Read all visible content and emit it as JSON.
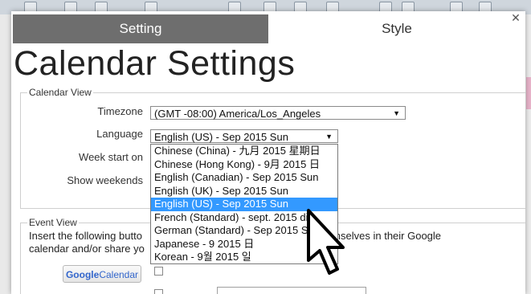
{
  "tabs": [
    {
      "label": "Setting"
    },
    {
      "label": "Style"
    }
  ],
  "page_title": "Calendar Settings",
  "calendar_view": {
    "legend": "Calendar View",
    "timezone_label": "Timezone",
    "timezone_value": "(GMT -08:00) America/Los_Angeles",
    "language_label": "Language",
    "language_value": "English (US) - Sep 2015 Sun",
    "week_start_label": "Week start on",
    "show_weekends_label": "Show weekends",
    "language_options": [
      {
        "label": "Chinese (China) - 九月 2015 星期日"
      },
      {
        "label": "Chinese (Hong Kong) - 9月 2015 日"
      },
      {
        "label": "English (Canadian) - Sep 2015 Sun"
      },
      {
        "label": "English (UK) - Sep 2015 Sun"
      },
      {
        "label": "English (US) - Sep 2015 Sun"
      },
      {
        "label": "French (Standard) - sept. 2015 di"
      },
      {
        "label": "German (Standard) - Sep 2015 So"
      },
      {
        "label": "Japanese - 9 2015 日"
      },
      {
        "label": "Korean - 9월 2015 일"
      }
    ],
    "selected_option_index": 4
  },
  "event_view": {
    "legend": "Event View",
    "text_line1": "Insert the following butto",
    "text_line1_end": "hind themselves in their Google",
    "text_line2": "calendar and/or share yo",
    "google_button": {
      "part1": "Google",
      "part2": "Calendar"
    }
  },
  "icons": {
    "close": "close-icon",
    "dropdown_arrow": "triangle-down-icon",
    "cursor": "mouse-pointer-icon"
  },
  "colors": {
    "active_tab_bg": "#6e6e6e",
    "selected_option_bg": "#3399ff"
  }
}
